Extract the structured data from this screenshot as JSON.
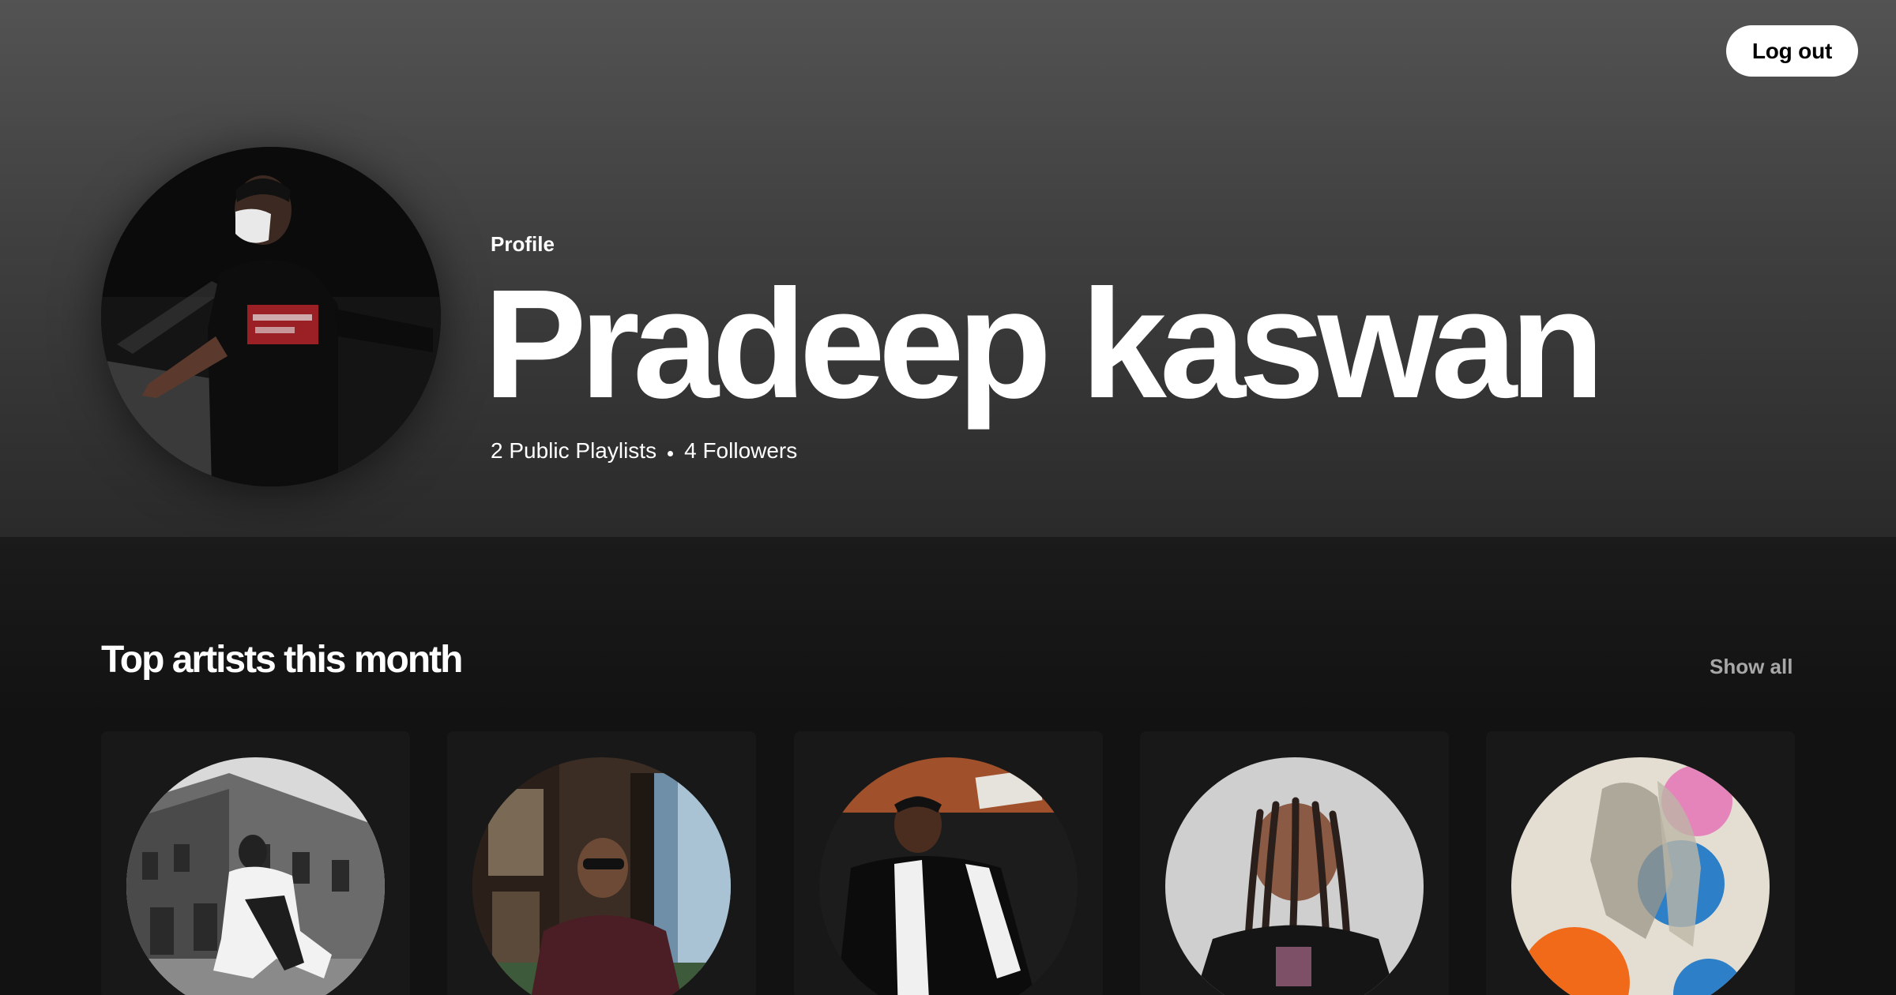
{
  "header": {
    "logout_label": "Log out",
    "profile_label": "Profile",
    "name": "Pradeep kaswan",
    "playlists_text": "2 Public Playlists",
    "followers_text": "4 Followers"
  },
  "section": {
    "title": "Top artists this month",
    "show_all_label": "Show all",
    "artists": [
      {
        "image_icon": "artist-photo-bw-building"
      },
      {
        "image_icon": "artist-photo-doorway"
      },
      {
        "image_icon": "artist-photo-white-shawl"
      },
      {
        "image_icon": "artist-photo-braids"
      },
      {
        "image_icon": "artist-photo-collage"
      }
    ]
  },
  "colors": {
    "header_top": "#535353",
    "header_bottom": "#2a2a2a",
    "background": "#121212",
    "card": "#181818",
    "muted_text": "#a7a7a7"
  }
}
